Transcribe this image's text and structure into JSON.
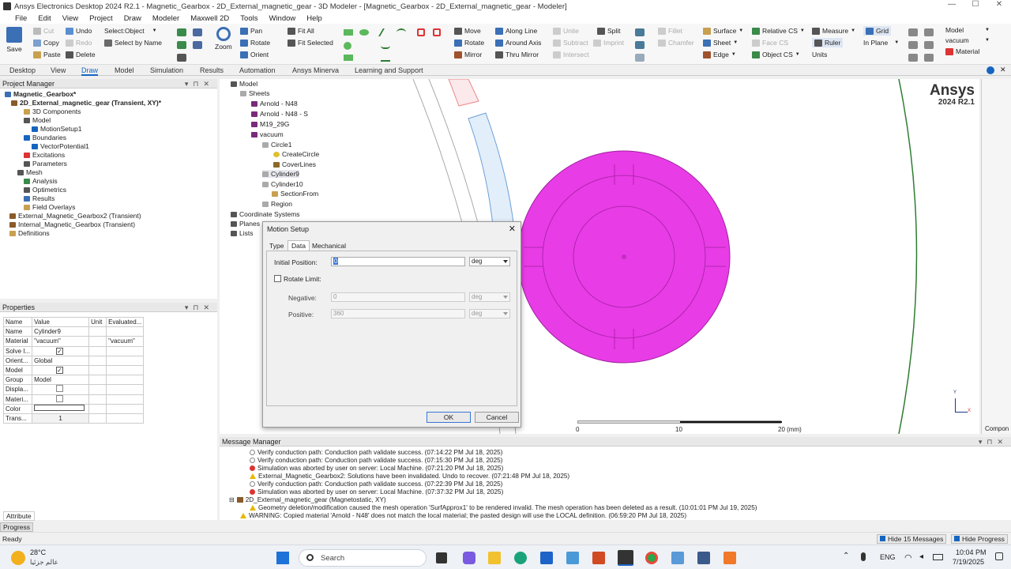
{
  "window": {
    "title": "Ansys Electronics Desktop 2024 R2.1 - Magnetic_Gearbox - 2D_External_magnetic_gear - 3D Modeler - [Magnetic_Gearbox - 2D_External_magnetic_gear - Modeler]",
    "minimize": "—",
    "maximize": "☐",
    "close": "✕"
  },
  "menu": [
    "File",
    "Edit",
    "View",
    "Project",
    "Draw",
    "Modeler",
    "Maxwell 2D",
    "Tools",
    "Window",
    "Help"
  ],
  "ribbon": {
    "save": "Save",
    "cut": "Cut",
    "copy": "Copy",
    "paste": "Paste",
    "undo": "Undo",
    "redo": "Redo",
    "delete": "Delete",
    "select_object": "Select:Object",
    "select_by_name": "Select by Name",
    "zoom": "Zoom",
    "pan": "Pan",
    "rotate": "Rotate",
    "orient": "Orient",
    "fit_all": "Fit All",
    "fit_selected": "Fit Selected",
    "move": "Move",
    "rotate2": "Rotate",
    "mirror": "Mirror",
    "along_line": "Along Line",
    "around_axis": "Around Axis",
    "thru_mirror": "Thru Mirror",
    "split": "Split",
    "unite": "Unite",
    "subtract": "Subtract",
    "intersect": "Intersect",
    "imprint": "Imprint",
    "fillet": "Fillet",
    "chamfer": "Chamfer",
    "surface": "Surface",
    "sheet": "Sheet",
    "edge": "Edge",
    "relative_cs": "Relative CS",
    "face_cs": "Face CS",
    "object_cs": "Object CS",
    "measure": "Measure",
    "ruler": "Ruler",
    "units": "Units",
    "grid": "Grid",
    "in_plane": "In Plane",
    "model_sel": "Model",
    "vacuum_sel": "vacuum",
    "material": "Material"
  },
  "tabs": [
    "Desktop",
    "View",
    "Draw",
    "Model",
    "Simulation",
    "Results",
    "Automation",
    "Ansys Minerva",
    "Learning and Support"
  ],
  "active_tab": "Draw",
  "project_manager": {
    "title": "Project Manager",
    "items": [
      "Magnetic_Gearbox*",
      "2D_External_magnetic_gear (Transient, XY)*",
      "3D Components",
      "Model",
      "MotionSetup1",
      "Boundaries",
      "VectorPotential1",
      "Excitations",
      "Parameters",
      "Mesh",
      "Analysis",
      "Optimetrics",
      "Results",
      "Field Overlays",
      "External_Magnetic_Gearbox2 (Transient)",
      "Internal_Magnetic_Gearbox (Transient)",
      "Definitions"
    ]
  },
  "properties": {
    "title": "Properties",
    "headers": [
      "Name",
      "Value",
      "Unit",
      "Evaluated..."
    ],
    "rows": [
      [
        "Name",
        "Cylinder9",
        "",
        ""
      ],
      [
        "Material",
        "\"vacuum\"",
        "",
        "\"vacuum\""
      ],
      [
        "Solve I...",
        "",
        "",
        ""
      ],
      [
        "Orient...",
        "Global",
        "",
        ""
      ],
      [
        "Model",
        "",
        "",
        ""
      ],
      [
        "Group",
        "Model",
        "",
        ""
      ],
      [
        "Displa...",
        "",
        "",
        ""
      ],
      [
        "Materi...",
        "",
        "",
        ""
      ],
      [
        "Color",
        "",
        "",
        ""
      ],
      [
        "Trans...",
        "1",
        "",
        ""
      ]
    ],
    "tab": "Attribute"
  },
  "history": {
    "items": [
      "Model",
      "Sheets",
      "Arnold - N48",
      "Arnold - N48 - S",
      "M19_29G",
      "vacuum",
      "Circle1",
      "CreateCircle",
      "CoverLines",
      "Cylinder9",
      "Cylinder10",
      "SectionFrom",
      "Region",
      "Coordinate Systems",
      "Planes",
      "Lists"
    ]
  },
  "viewport": {
    "brand": "Ansys",
    "version": "2024 R2.1",
    "scale_labels": [
      "0",
      "10",
      "20 (mm)"
    ],
    "axis_y": "Y",
    "axis_x": "X",
    "right_label": "Compon"
  },
  "dialog": {
    "title": "Motion Setup",
    "tabs": [
      "Type",
      "Data",
      "Mechanical"
    ],
    "active_tab": "Data",
    "initial_position_label": "Initial Position:",
    "initial_position_value": "0",
    "initial_position_unit": "deg",
    "rotate_limit_label": "Rotate Limit:",
    "negative_label": "Negative:",
    "negative_value": "0",
    "negative_unit": "deg",
    "positive_label": "Positive:",
    "positive_value": "360",
    "positive_unit": "deg",
    "ok": "OK",
    "cancel": "Cancel"
  },
  "messages": {
    "title": "Message Manager",
    "rows": [
      {
        "t": "info",
        "text": "Verify conduction path: Conduction path validate success. (07:14:22 PM  Jul 18, 2025)"
      },
      {
        "t": "info",
        "text": "Verify conduction path: Conduction path validate success. (07:15:30 PM  Jul 18, 2025)"
      },
      {
        "t": "err",
        "text": "Simulation was aborted by user on server: Local Machine. (07:21:20 PM  Jul 18, 2025)"
      },
      {
        "t": "warn",
        "text": "External_Magnetic_Gearbox2: Solutions have been invalidated. Undo to recover. (07:21:48 PM  Jul 18, 2025)"
      },
      {
        "t": "info",
        "text": "Verify conduction path: Conduction path validate success. (07:22:39 PM  Jul 18, 2025)"
      },
      {
        "t": "err",
        "text": "Simulation was aborted by user on server: Local Machine. (07:37:32 PM  Jul 18, 2025)"
      }
    ],
    "group": "2D_External_magnetic_gear (Magnetostatic, XY)",
    "group_rows": [
      {
        "t": "warn",
        "text": "Geometry deletion/modification caused the mesh operation 'SurfApprox1' to be rendered invalid. The mesh operation has been deleted as a result. (10:01:01 PM  Jul 19, 2025)"
      },
      {
        "t": "warn",
        "text": "WARNING: Copied material 'Arnold - N48' does not match the local material; the pasted design will use the LOCAL definition. (06:59:20 PM  Jul 18, 2025)"
      }
    ]
  },
  "progress": {
    "label": "Progress"
  },
  "status": {
    "text": "Ready",
    "hide_messages": "Hide 15 Messages",
    "hide_progress": "Hide Progress"
  },
  "taskbar": {
    "temp": "28°C",
    "weather": "عالم جزئيا",
    "search": "Search",
    "lang": "ENG",
    "time": "10:04 PM",
    "date": "7/19/2025"
  },
  "colors": {
    "magenta": "#e83ce6",
    "accent": "#1565c0",
    "green": "#2e7d32"
  }
}
